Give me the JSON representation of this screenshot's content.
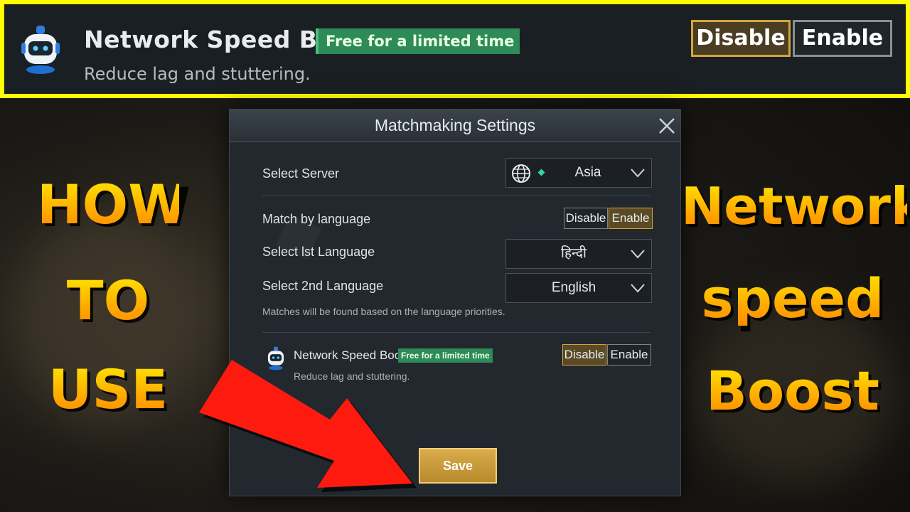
{
  "banner": {
    "title": "Network Speed Boost",
    "tag": "Free for a limited time",
    "subtitle": "Reduce lag and stuttering.",
    "disable_label": "Disable",
    "enable_label": "Enable",
    "selected": "Disable",
    "border_color": "#ffff00"
  },
  "dialog": {
    "title": "Matchmaking Settings",
    "server": {
      "label": "Select Server",
      "value": "Asia",
      "icon": "globe-icon"
    },
    "match_by_language": {
      "label": "Match by language",
      "disable_label": "Disable",
      "enable_label": "Enable",
      "selected": "Enable"
    },
    "first_language": {
      "label": "Select lst Language",
      "value": "हिन्दी"
    },
    "second_language": {
      "label": "Select 2nd Language",
      "value": "English"
    },
    "hint": "Matches will be found based on the language priorities.",
    "network_boost": {
      "title": "Network Speed Boost",
      "tag": "Free for a limited time",
      "subtitle": "Reduce lag and stuttering.",
      "disable_label": "Disable",
      "enable_label": "Enable",
      "selected": "Disable"
    },
    "save_label": "Save"
  },
  "overlay": {
    "left_lines": [
      "HOW",
      "TO",
      "USE"
    ],
    "right_lines": [
      "Network",
      "speed",
      "Boost"
    ],
    "accent": "#ffc000",
    "arrow_color": "#ff1a10"
  }
}
